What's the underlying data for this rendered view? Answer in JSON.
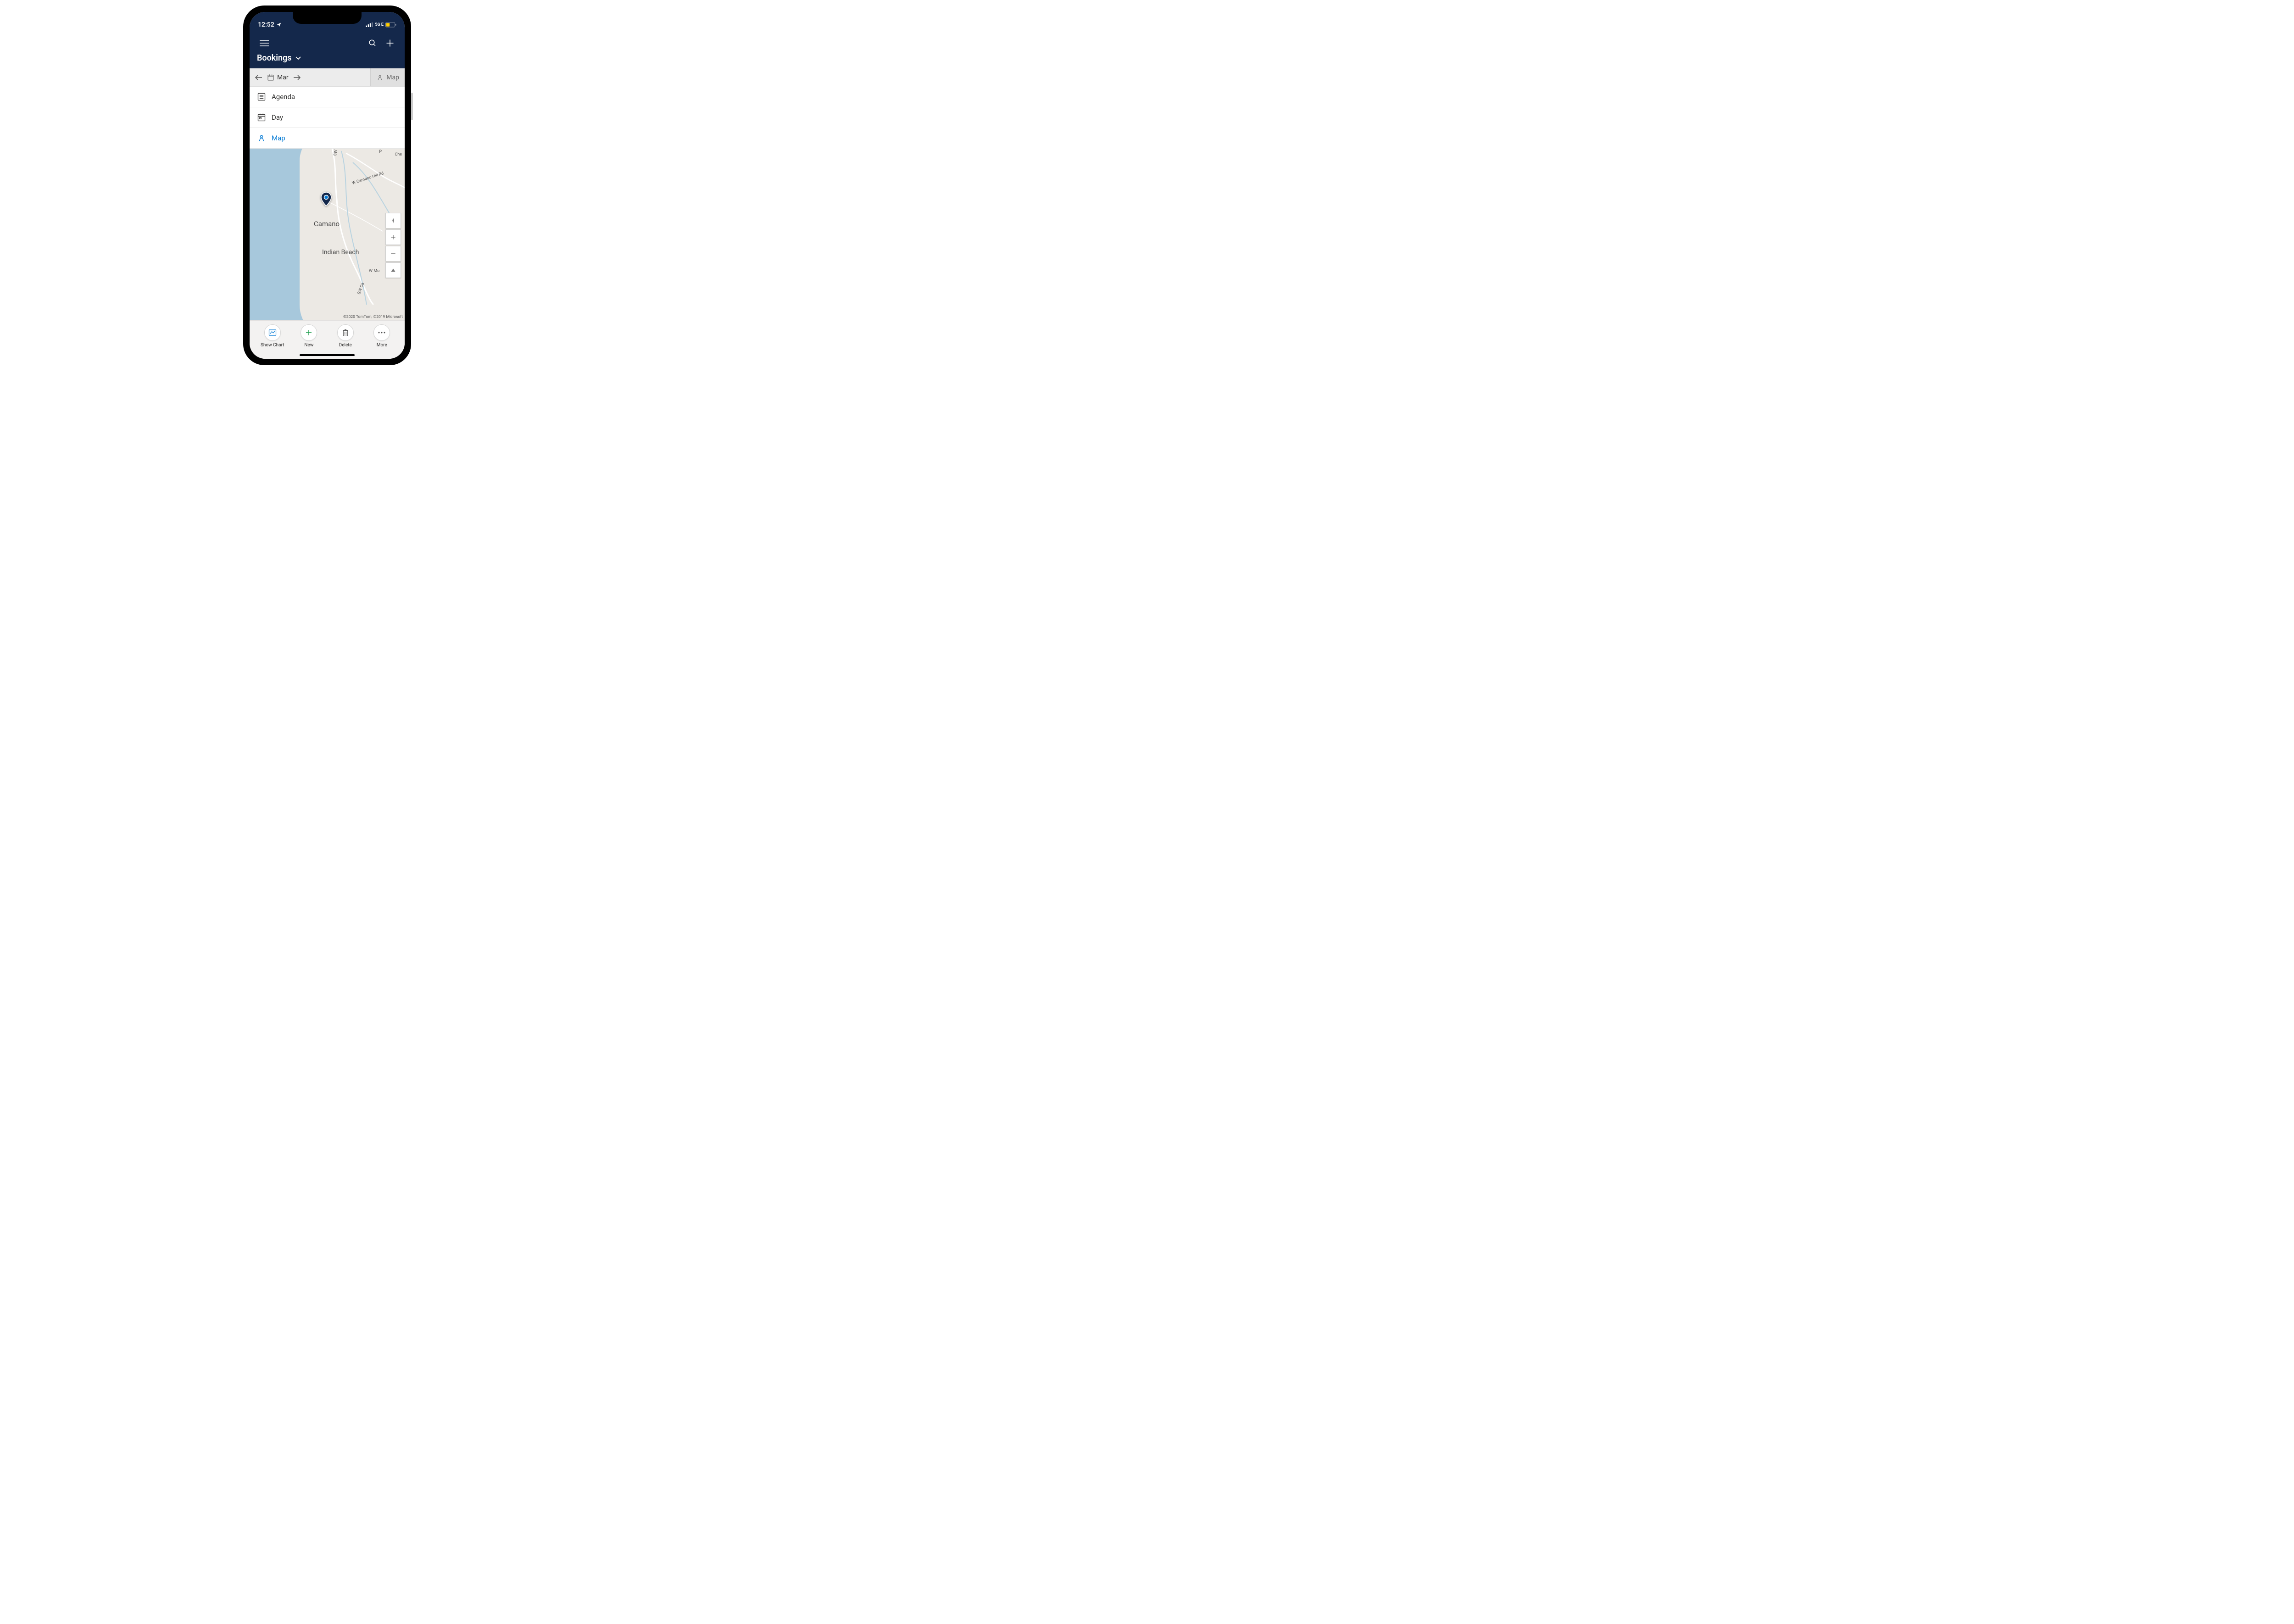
{
  "status": {
    "time": "12:52",
    "network": "5G E"
  },
  "header": {
    "title": "Bookings"
  },
  "datebar": {
    "month": "Mar",
    "mode_label": "Map"
  },
  "views": {
    "agenda": "Agenda",
    "day": "Day",
    "map": "Map"
  },
  "map": {
    "places": {
      "camano": "Camano",
      "indian_beach": "Indian Beach",
      "sw_camano_dr": "SW Camano Dr",
      "w_camano_hill": "W Camano Hill Rd",
      "w_mo": "W Mo",
      "che": "Che",
      "p": "P",
      "sw_ca": "SW Ca"
    },
    "attribution": "©2020 TomTom, ©2019 Microsoft"
  },
  "bottom": {
    "show_chart": "Show Chart",
    "new": "New",
    "delete": "Delete",
    "more": "More"
  }
}
